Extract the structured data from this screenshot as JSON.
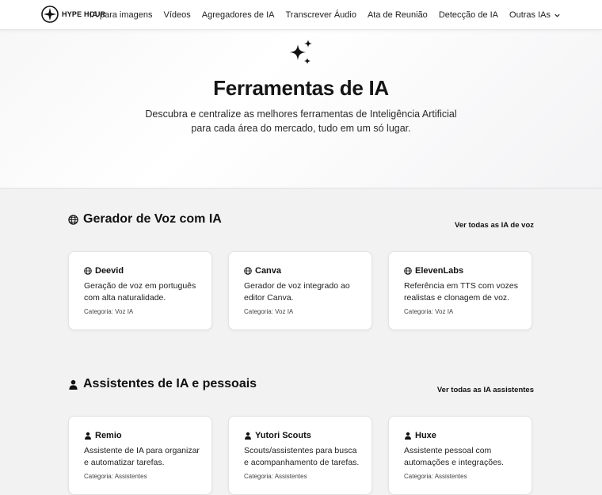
{
  "brand": {
    "name": "HYPE HOUR"
  },
  "nav": {
    "items": [
      "IA para imagens",
      "Vídeos",
      "Agregadores de IA",
      "Transcrever Áudio",
      "Ata de Reunião",
      "Detecção de IA"
    ],
    "more_label": "Outras IAs"
  },
  "hero": {
    "title": "Ferramentas de IA",
    "subtitle": "Descubra e centralize as melhores ferramentas de Inteligência Artificial para cada área do mercado, tudo em um só lugar."
  },
  "sections": [
    {
      "icon": "globe-icon",
      "title": "Gerador de Voz com IA",
      "link": "Ver todas as IA de voz",
      "cards": [
        {
          "name": "Deevid",
          "desc": "Geração de voz em português com alta naturalidade.",
          "category": "Categoria: Voz IA"
        },
        {
          "name": "Canva",
          "desc": "Gerador de voz integrado ao editor Canva.",
          "category": "Categoria: Voz IA"
        },
        {
          "name": "ElevenLabs",
          "desc": "Referência em TTS com vozes realistas e clonagem de voz.",
          "category": "Categoria: Voz IA"
        }
      ]
    },
    {
      "icon": "user-icon",
      "title": "Assistentes de IA e pessoais",
      "link": "Ver todas as IA assistentes",
      "cards": [
        {
          "name": "Remio",
          "desc": "Assistente de IA para organizar e automatizar tarefas.",
          "category": "Categoria: Assistentes"
        },
        {
          "name": "Yutori Scouts",
          "desc": "Scouts/assistentes para busca e acompanhamento de tarefas.",
          "category": "Categoria: Assistentes"
        },
        {
          "name": "Huxe",
          "desc": "Assistente pessoal com automações e integrações.",
          "category": "Categoria: Assistentes"
        }
      ]
    }
  ]
}
